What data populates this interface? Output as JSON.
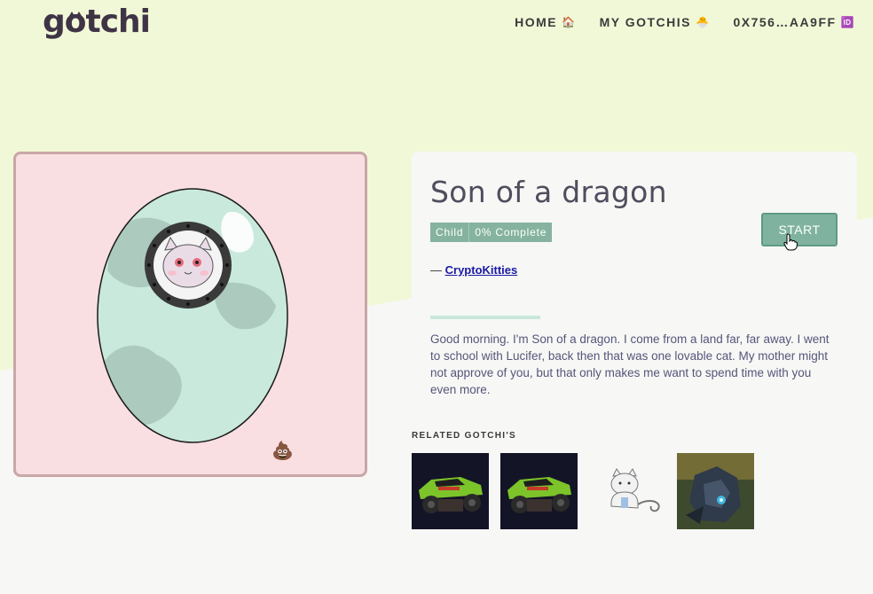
{
  "brand": {
    "logo_text": "gotchi"
  },
  "nav": {
    "items": [
      {
        "label": "HOME",
        "emoji": "🏠"
      },
      {
        "label": "MY GOTCHIS",
        "emoji": "🐣"
      },
      {
        "label": "0X756…AA9FF",
        "emoji": "🆔"
      }
    ]
  },
  "gotchi": {
    "name": "Son of a dragon",
    "stage": "Child",
    "progress": "0% Complete",
    "progress_value": 0,
    "author_prefix": "— ",
    "author": "CryptoKitties",
    "description": "Good morning. I'm Son of a dragon. I come from a land far, far away. I went to school with Lucifer, back then that was one lovable cat. My mother might not approve of you, but that only makes me want to spend time with you even more.",
    "status_emoji": "💩"
  },
  "actions": {
    "start_label": "START"
  },
  "related": {
    "title": "RELATED GOTCHI'S",
    "items": [
      "green-car-1",
      "green-car-2",
      "white-cat",
      "robot-mech"
    ]
  },
  "colors": {
    "top_bg": "#f1f8d7",
    "card_pink": "#f9dfe1",
    "accent_green": "#85b39f",
    "egg_fill": "#c9e9dc"
  }
}
